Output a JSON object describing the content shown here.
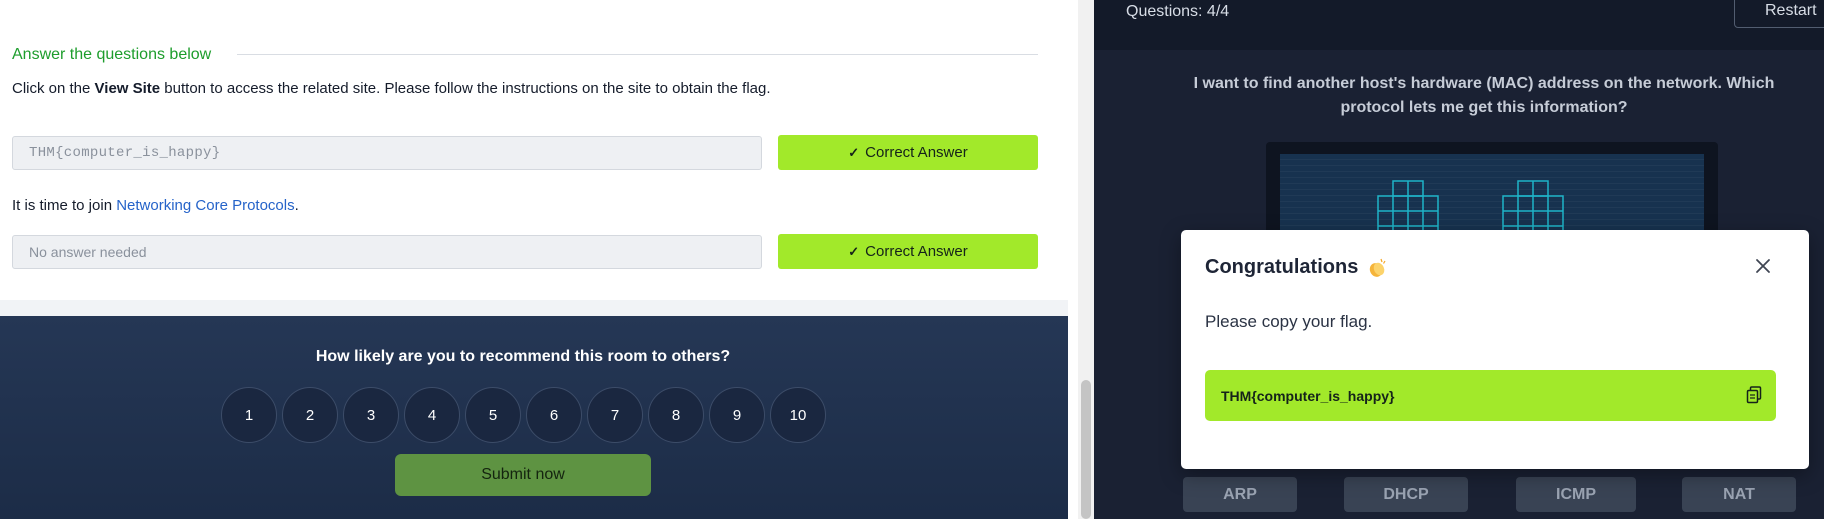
{
  "task": {
    "section_heading": "Answer the questions below",
    "q1": {
      "before": "Click on the ",
      "bold": "View Site",
      "after": " button to access the related site. Please follow the instructions on the site to obtain the flag."
    },
    "a1": {
      "value": "THM{computer_is_happy}",
      "button": "Correct Answer"
    },
    "q2": {
      "before": "It is time to join ",
      "link": "Networking Core Protocols",
      "after": "."
    },
    "a2": {
      "value": "No answer needed",
      "button": "Correct Answer"
    }
  },
  "feedback": {
    "question": "How likely are you to recommend this room to others?",
    "ratings": [
      "1",
      "2",
      "3",
      "4",
      "5",
      "6",
      "7",
      "8",
      "9",
      "10"
    ],
    "submit": "Submit now"
  },
  "quiz": {
    "counter": "Questions: 4/4",
    "restart": "Restart",
    "question": "I want to find another host's hardware (MAC) address on the network. Which protocol lets me get this information?",
    "options": [
      "ARP",
      "DHCP",
      "ICMP",
      "NAT"
    ]
  },
  "modal": {
    "title": "Congratulations",
    "message": "Please copy your flag.",
    "flag": "THM{computer_is_happy}"
  },
  "colors": {
    "accent_green": "#a2e92a",
    "link_blue": "#2563c9",
    "heading_green": "#1d9d2c",
    "dark_panel": "#1a2133"
  },
  "icons": [
    "check-icon",
    "clapping-hands-icon",
    "close-icon",
    "copy-icon"
  ]
}
